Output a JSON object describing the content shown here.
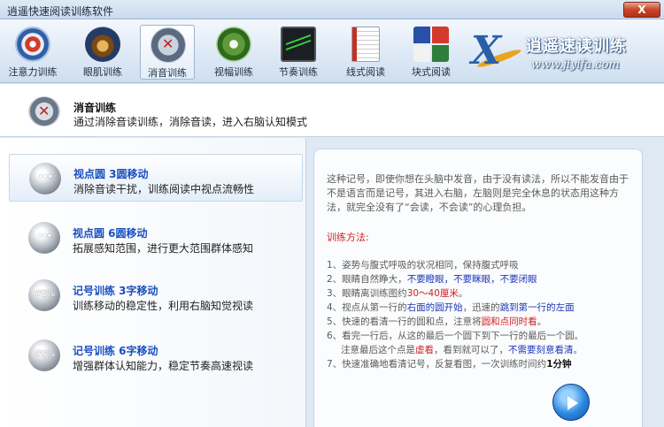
{
  "window": {
    "title": "逍遥快速阅读训练软件",
    "close_label": "X"
  },
  "toolbar": [
    {
      "label": "注意力训练",
      "icon": "target-icon"
    },
    {
      "label": "眼肌训练",
      "icon": "eye-icon"
    },
    {
      "label": "消音训练",
      "icon": "mute-speaker-icon"
    },
    {
      "label": "视幅训练",
      "icon": "expand-arrows-icon"
    },
    {
      "label": "节奏训练",
      "icon": "monitor-wave-icon"
    },
    {
      "label": "线式阅读",
      "icon": "notebook-icon"
    },
    {
      "label": "块式阅读",
      "icon": "blocks-icon"
    }
  ],
  "brand": {
    "name": "逍遥速读训练",
    "url": "www.jiyifa.com"
  },
  "header": {
    "title": "消音训练",
    "desc": "通过消除音读训练，消除音读，进入右脑认知模式"
  },
  "items": [
    {
      "title": "视点圆 3圆移动",
      "desc": "消除音读干扰，训练阅读中视点流畅性",
      "glyph": "•••"
    },
    {
      "title": "视点圆 6圆移动",
      "desc": "拓展感知范围，进行更大范围群体感知",
      "glyph": "•••"
    },
    {
      "title": "记号训练 3字移动",
      "desc": "训练移动的稳定性，利用右脑知觉视读",
      "glyph": "#$%"
    },
    {
      "title": "记号训练 6字移动",
      "desc": "增强群体认知能力，稳定节奏高速视读",
      "glyph": "#$%"
    }
  ],
  "description": {
    "intro": "这种记号，即使你想在头脑中发音，由于没有读法，所以不能发音由于不是语言而是记号，其进入右脑，左脑则是完全休息的状态用这种方法，就完全没有了“会读，不会读”的心理负担。",
    "method_title": "训练方法:",
    "s1": "1、姿势与腹式呼吸的状况相同，保持腹式呼吸",
    "s2a": "2、眼睛自然睁大，",
    "s2b": "不要瞪眼，不要眯眼，不要闭眼",
    "s3a": "3、眼睛离训练图约",
    "s3b": "30～40厘米",
    "s3c": "。",
    "s4a": "4、视点从第一行的",
    "s4b": "右面的圆开始",
    "s4c": "，迅速的",
    "s4d": "跳到第一行的左面",
    "s5a": "5、快速的看清一行的圆和点，注意将",
    "s5b": "圆和点同时看",
    "s5c": "。",
    "s6": "6、看完一行后，从这的最后一个圆下到下一行的最后一个圆。",
    "s6ba": "注意最后这个点是",
    "s6bb": "虚看",
    "s6bc": "，看到就可以了，",
    "s6bd": "不需要刻意看清",
    "s6be": "。",
    "s7a": "7、快速准确地看清记号，反复看图，一次训练时间约",
    "s7b": "1分钟"
  }
}
